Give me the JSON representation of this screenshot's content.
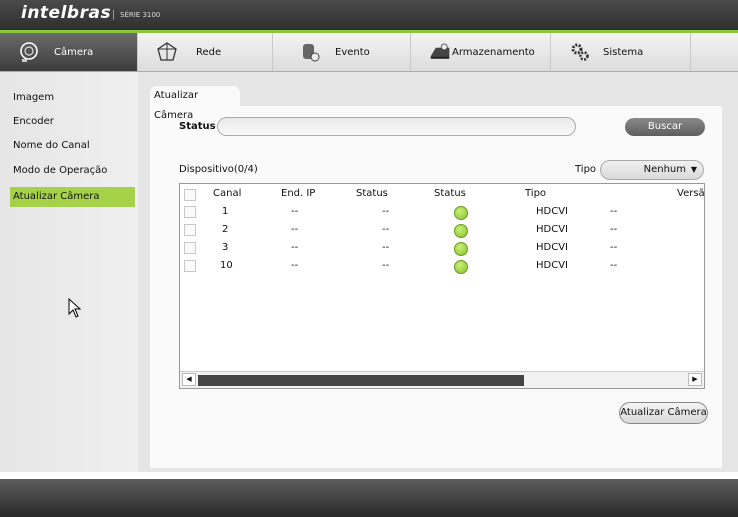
{
  "brand": {
    "name": "intelbras",
    "series": "SÉRIE 3100"
  },
  "nav": {
    "items": [
      {
        "label": "Câmera",
        "icon": "camera-icon"
      },
      {
        "label": "Rede",
        "icon": "network-icon"
      },
      {
        "label": "Evento",
        "icon": "event-icon"
      },
      {
        "label": "Armazenamento",
        "icon": "storage-icon"
      },
      {
        "label": "Sistema",
        "icon": "system-gear-icon"
      }
    ]
  },
  "sidebar": {
    "items": [
      {
        "label": "Imagem"
      },
      {
        "label": "Encoder"
      },
      {
        "label": "Nome do Canal"
      },
      {
        "label": "Modo de Operação"
      },
      {
        "label": "Atualizar Câmera"
      }
    ]
  },
  "tab": {
    "label": "Atualizar Câmera"
  },
  "status": {
    "label": "Status",
    "value": ""
  },
  "buscar": {
    "label": "Buscar"
  },
  "device": {
    "count_label": "Dispositivo(0/4)"
  },
  "tipo": {
    "label": "Tipo",
    "value": "Nenhum"
  },
  "table": {
    "headers": [
      "Canal",
      "End. IP",
      "Status",
      "Status",
      "Tipo",
      "Versã"
    ],
    "rows": [
      {
        "canal": "1",
        "ip": "--",
        "status": "--",
        "tipo": "HDCVI",
        "versao": "--"
      },
      {
        "canal": "2",
        "ip": "--",
        "status": "--",
        "tipo": "HDCVI",
        "versao": "--"
      },
      {
        "canal": "3",
        "ip": "--",
        "status": "--",
        "tipo": "HDCVI",
        "versao": "--"
      },
      {
        "canal": "10",
        "ip": "--",
        "status": "--",
        "tipo": "HDCVI",
        "versao": "--"
      }
    ]
  },
  "actions": {
    "update_label": "Atualizar Câmera"
  },
  "colors": {
    "accent": "#a6d24a",
    "status_ok": "#86c12a",
    "topbar": "#3a3a3a"
  }
}
